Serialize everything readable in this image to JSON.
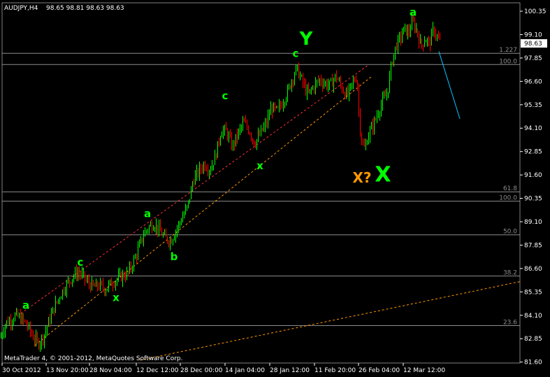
{
  "header": {
    "symbol": "AUDJPY,H4",
    "ohlc": "98.65 98.81 98.63 98.63"
  },
  "footer": {
    "copyright": "MetaTrader 4, © 2001-2012, MetaQuotes Software Corp."
  },
  "colors": {
    "background": "#000000",
    "bull_candle": "#00ff00",
    "bear_candle": "#ff0000",
    "fib_lines": "#8c8c8c",
    "wave_labels": "#00ff00",
    "alt_label": "#ff9900",
    "projection_line": "#00c8ff",
    "channel_upper": "#ff3030",
    "channel_lower": "#ff9900"
  },
  "chart_data": {
    "type": "candlestick",
    "ylim": [
      81.55,
      100.8
    ],
    "y_ticks": [
      "100.35",
      "99.10",
      "97.85",
      "96.60",
      "95.35",
      "94.10",
      "92.85",
      "91.60",
      "90.35",
      "89.10",
      "87.85",
      "86.60",
      "85.35",
      "84.10",
      "82.85",
      "81.60"
    ],
    "current_price": "98.63",
    "x_ticks": [
      "30 Oct 2012",
      "13 Nov 20:00",
      "28 Nov 04:00",
      "12 Dec 12:00",
      "28 Dec 00:00",
      "14 Jan 04:00",
      "28 Jan 12:00",
      "11 Feb 20:00",
      "26 Feb 04:00",
      "12 Mar 12:00"
    ],
    "price_path": [
      [
        0,
        82.9
      ],
      [
        8,
        83.7
      ],
      [
        16,
        83.9
      ],
      [
        22,
        84.1
      ],
      [
        30,
        83.9
      ],
      [
        38,
        83.6
      ],
      [
        46,
        83.0
      ],
      [
        54,
        82.6
      ],
      [
        62,
        83.0
      ],
      [
        70,
        83.8
      ],
      [
        78,
        84.6
      ],
      [
        86,
        85.2
      ],
      [
        94,
        85.7
      ],
      [
        102,
        86.1
      ],
      [
        110,
        86.4
      ],
      [
        118,
        86.2
      ],
      [
        126,
        85.8
      ],
      [
        134,
        85.6
      ],
      [
        142,
        85.7
      ],
      [
        150,
        85.5
      ],
      [
        158,
        85.8
      ],
      [
        166,
        86.0
      ],
      [
        174,
        86.2
      ],
      [
        182,
        86.3
      ],
      [
        190,
        86.9
      ],
      [
        198,
        87.7
      ],
      [
        206,
        88.5
      ],
      [
        212,
        88.8
      ],
      [
        220,
        89.0
      ],
      [
        228,
        88.6
      ],
      [
        236,
        88.2
      ],
      [
        244,
        88.1
      ],
      [
        252,
        88.7
      ],
      [
        260,
        89.3
      ],
      [
        268,
        89.9
      ],
      [
        276,
        91.3
      ],
      [
        284,
        91.8
      ],
      [
        292,
        92.2
      ],
      [
        300,
        91.9
      ],
      [
        308,
        92.6
      ],
      [
        316,
        94.0
      ],
      [
        324,
        93.9
      ],
      [
        332,
        93.1
      ],
      [
        340,
        93.8
      ],
      [
        348,
        94.4
      ],
      [
        356,
        94.0
      ],
      [
        364,
        93.3
      ],
      [
        372,
        93.8
      ],
      [
        380,
        94.3
      ],
      [
        388,
        95.2
      ],
      [
        396,
        95.0
      ],
      [
        404,
        95.5
      ],
      [
        412,
        96.1
      ],
      [
        418,
        96.8
      ],
      [
        424,
        97.3
      ],
      [
        432,
        96.6
      ],
      [
        440,
        95.9
      ],
      [
        448,
        96.3
      ],
      [
        456,
        96.7
      ],
      [
        464,
        96.5
      ],
      [
        472,
        96.4
      ],
      [
        480,
        96.9
      ],
      [
        488,
        96.3
      ],
      [
        496,
        95.8
      ],
      [
        504,
        96.5
      ],
      [
        510,
        96.9
      ],
      [
        514,
        94.4
      ],
      [
        518,
        93.2
      ],
      [
        522,
        93.0
      ],
      [
        526,
        93.7
      ],
      [
        530,
        94.0
      ],
      [
        536,
        94.5
      ],
      [
        542,
        95.1
      ],
      [
        548,
        95.6
      ],
      [
        554,
        96.0
      ],
      [
        560,
        97.6
      ],
      [
        566,
        98.5
      ],
      [
        572,
        98.9
      ],
      [
        578,
        99.4
      ],
      [
        584,
        99.2
      ],
      [
        590,
        99.8
      ],
      [
        596,
        99.3
      ],
      [
        602,
        98.5
      ],
      [
        608,
        98.9
      ],
      [
        614,
        98.6
      ],
      [
        620,
        99.4
      ],
      [
        626,
        98.9
      ],
      [
        630,
        98.63
      ]
    ],
    "fib_levels": [
      {
        "label": "1.227",
        "price": 98.1
      },
      {
        "label": "100.0",
        "price": 97.5
      },
      {
        "label": "61.8",
        "price": 90.7
      },
      {
        "label": "100.0",
        "price": 90.2
      },
      {
        "label": "50.0",
        "price": 88.4
      },
      {
        "label": "38.2",
        "price": 86.2
      },
      {
        "label": "23.6",
        "price": 83.55
      }
    ],
    "wave_labels": [
      {
        "text": "a",
        "x": 37,
        "y": 84.45,
        "size": 15
      },
      {
        "text": "c",
        "x": 115,
        "y": 86.75,
        "size": 15
      },
      {
        "text": "x",
        "x": 166,
        "y": 84.85,
        "size": 15
      },
      {
        "text": "a",
        "x": 211,
        "y": 89.35,
        "size": 15
      },
      {
        "text": "b",
        "x": 249,
        "y": 87.05,
        "size": 15
      },
      {
        "text": "c",
        "x": 322,
        "y": 95.65,
        "size": 15
      },
      {
        "text": "x",
        "x": 372,
        "y": 91.9,
        "size": 15
      },
      {
        "text": "c",
        "x": 423,
        "y": 97.9,
        "size": 15
      },
      {
        "text": "Y",
        "x": 438,
        "y": 98.55,
        "size": 26
      },
      {
        "text": "X",
        "x": 548,
        "y": 91.25,
        "size": 30
      },
      {
        "text": "a",
        "x": 591,
        "y": 100.1,
        "size": 15
      }
    ],
    "alt_labels": [
      {
        "text": "X?",
        "x": 518,
        "y": 91.2,
        "size": 20
      }
    ],
    "channel_upper": [
      [
        30,
        84.2
      ],
      [
        528,
        97.5
      ]
    ],
    "channel_lower": [
      [
        50,
        82.5
      ],
      [
        533,
        96.9
      ]
    ],
    "support_line": [
      [
        200,
        81.7
      ],
      [
        744,
        85.9
      ]
    ],
    "projection_line": [
      [
        628,
        98.2
      ],
      [
        658,
        94.6
      ]
    ]
  }
}
